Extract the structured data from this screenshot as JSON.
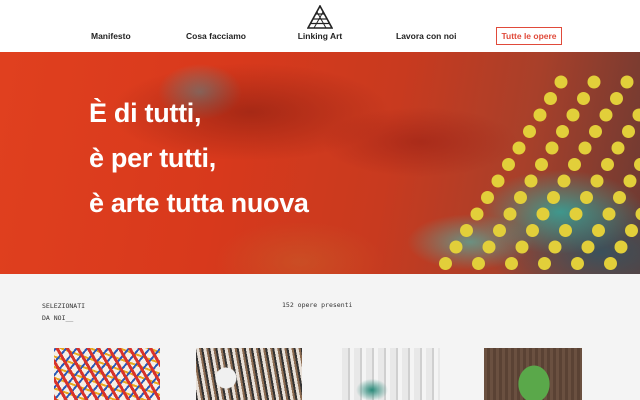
{
  "header": {
    "nav": [
      "Manifesto",
      "Cosa facciamo",
      "Lavora con noi"
    ],
    "logo_text": "Linking Art",
    "cta_label": "Tutte le opere"
  },
  "hero": {
    "lines": [
      "È di tutti,",
      "è per tutti,",
      "è arte tutta nuova"
    ]
  },
  "selection": {
    "label_line1": "SELEZIONATI",
    "label_line2": "DA NOI__",
    "count_text": "152 opere presenti"
  },
  "colors": {
    "accent": "#e04a3a",
    "dots": "#e2cf3a",
    "hero_base": "#d8391c"
  }
}
